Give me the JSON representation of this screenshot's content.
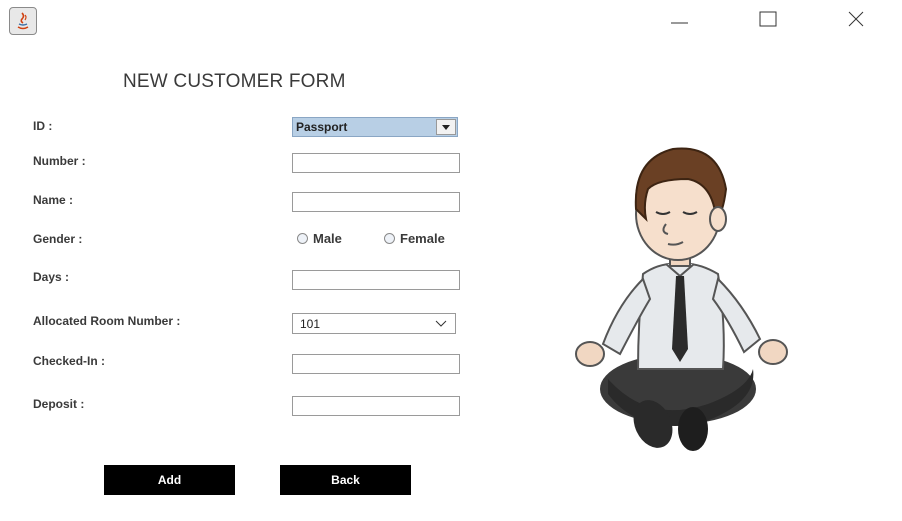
{
  "window": {
    "controls": [
      "minimize-icon",
      "maximize-icon",
      "close-icon"
    ]
  },
  "form": {
    "title": "NEW CUSTOMER FORM",
    "labels": {
      "id": "ID :",
      "number": "Number :",
      "name": "Name :",
      "gender": "Gender :",
      "days": "Days :",
      "room": "Allocated Room Number :",
      "checked_in": "Checked-In :",
      "deposit": "Deposit :"
    },
    "id_type": "Passport",
    "gender_options": {
      "male": "Male",
      "female": "Female"
    },
    "room_number": "101",
    "number_value": "",
    "name_value": "",
    "days_value": "",
    "checked_in_value": "",
    "deposit_value": ""
  },
  "buttons": {
    "add": "Add",
    "back": "Back"
  },
  "colors": {
    "combo_selected": "#b8cfe5",
    "button_bg": "#000000",
    "button_text": "#ffffff"
  }
}
